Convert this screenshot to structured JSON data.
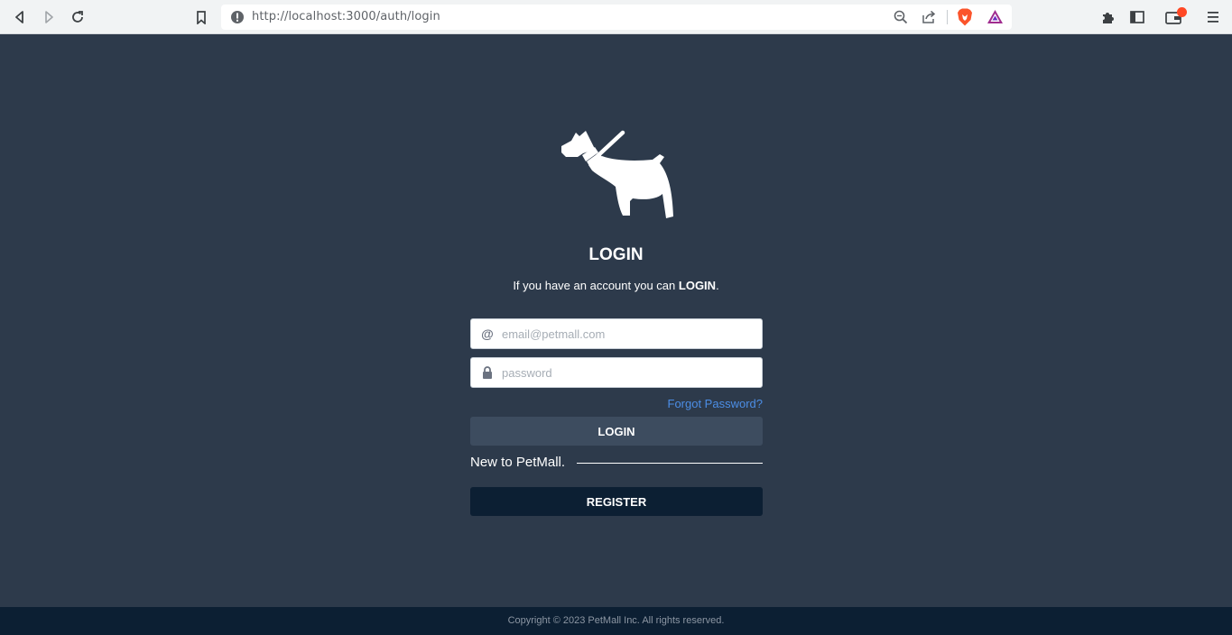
{
  "browser": {
    "url": "http://localhost:3000/auth/login",
    "icons": [
      "back-icon",
      "forward-icon",
      "reload-icon",
      "bookmark-icon",
      "site-info-icon",
      "zoom-icon",
      "share-icon",
      "brave-shield-icon",
      "brave-rewards-icon",
      "extensions-icon",
      "sidebar-icon",
      "wallet-icon",
      "menu-icon"
    ]
  },
  "login": {
    "title": "LOGIN",
    "subtitle_prefix": "If you have an account you can ",
    "subtitle_bold": "LOGIN",
    "subtitle_suffix": ".",
    "email_placeholder": "email@petmall.com",
    "email_icon": "@",
    "password_placeholder": "password",
    "forgot_password": "Forgot Password?",
    "login_button": "LOGIN",
    "new_to": "New to PetMall.",
    "register_button": "REGISTER"
  },
  "footer": {
    "copyright": "Copyright © 2023 PetMall Inc. All rights reserved."
  },
  "colors": {
    "background": "#2d3a4b",
    "login_button": "#3d4c5f",
    "register_button": "#0c1f33",
    "footer": "#0c1f33",
    "link": "#4c8ee6"
  }
}
